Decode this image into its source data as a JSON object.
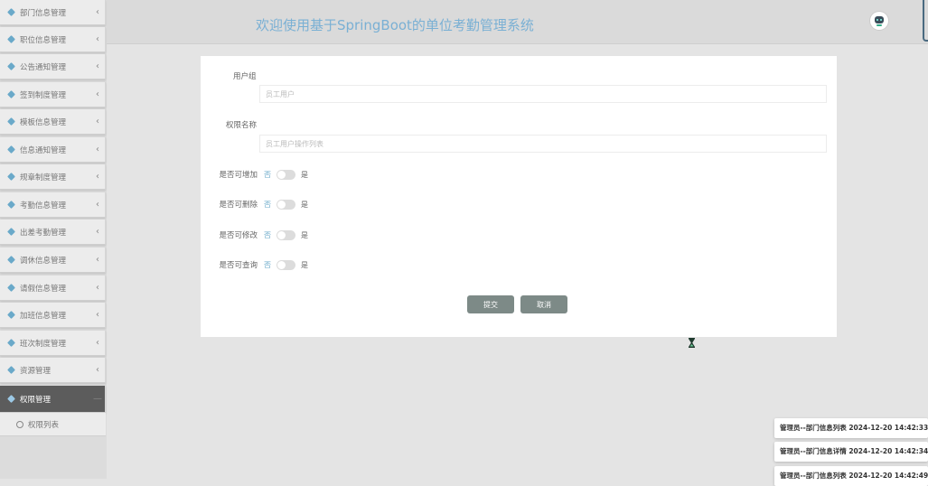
{
  "sidebar": {
    "items": [
      {
        "label": "部门信息管理"
      },
      {
        "label": "职位信息管理"
      },
      {
        "label": "公告通知管理"
      },
      {
        "label": "签到制度管理"
      },
      {
        "label": "模板信息管理"
      },
      {
        "label": "信息通知管理"
      },
      {
        "label": "规章制度管理"
      },
      {
        "label": "考勤信息管理"
      },
      {
        "label": "出差考勤管理"
      },
      {
        "label": "调休信息管理"
      },
      {
        "label": "请假信息管理"
      },
      {
        "label": "加班信息管理"
      },
      {
        "label": "班次制度管理"
      },
      {
        "label": "资源管理"
      },
      {
        "label": "权限管理"
      }
    ],
    "active_index": 14,
    "sub_item": {
      "label": "权限列表"
    },
    "chevron": "‹"
  },
  "header": {
    "title": "欢迎使用基于SpringBoot的单位考勤管理系统",
    "avatar_icon": "robot-avatar"
  },
  "form": {
    "user_group_label": "用户组",
    "user_group_value": "员工用户",
    "perm_name_label": "权限名称",
    "perm_name_value": "员工用户操作列表",
    "toggles": [
      {
        "label": "是否可增加",
        "no": "否",
        "yes": "是"
      },
      {
        "label": "是否可删除",
        "no": "否",
        "yes": "是"
      },
      {
        "label": "是否可修改",
        "no": "否",
        "yes": "是"
      },
      {
        "label": "是否可查询",
        "no": "否",
        "yes": "是"
      }
    ],
    "submit_label": "提交",
    "cancel_label": "取消"
  },
  "notifications": [
    {
      "text": "管理员--部门信息列表 2024-12-20 14:42:33"
    },
    {
      "text": "管理员--部门信息详情 2024-12-20 14:42:34"
    },
    {
      "text": "管理员--部门信息列表 2024-12-20 14:42:49"
    }
  ],
  "colors": {
    "accent": "#7ab0d4",
    "button": "#7d8a87",
    "active_sidebar": "#5c5c5c"
  }
}
